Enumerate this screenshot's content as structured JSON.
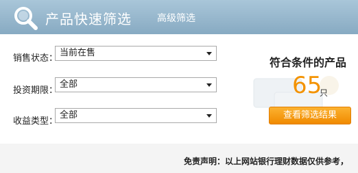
{
  "header": {
    "title": "产品快速筛选",
    "advanced_link": "高级筛选"
  },
  "filters": [
    {
      "label": "销售状态：",
      "value": "当前在售"
    },
    {
      "label": "投资期限：",
      "value": "全部"
    },
    {
      "label": "收益类型：",
      "value": "全部"
    }
  ],
  "result": {
    "title": "符合条件的产品",
    "count": "65",
    "unit": "只",
    "button_label": "查看筛选结果"
  },
  "footer": {
    "disclaimer": "免责声明：以上网站银行理财数据仅供参考，"
  },
  "colors": {
    "header": "#97b7cc",
    "accent": "#f39200"
  }
}
